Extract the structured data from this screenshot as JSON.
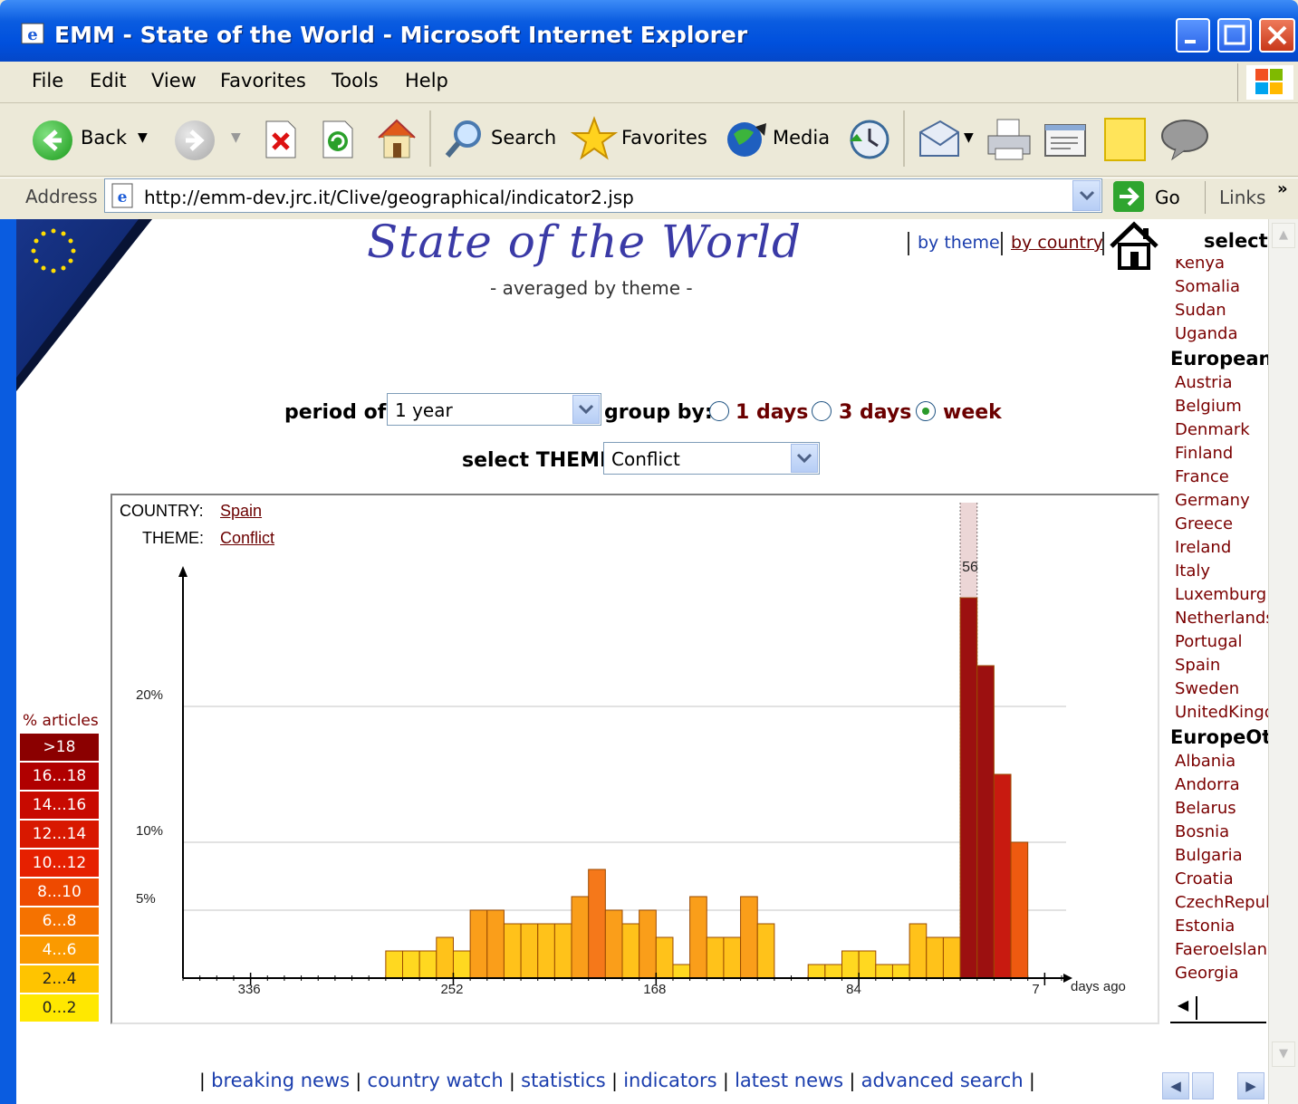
{
  "window": {
    "title": "EMM - State of the World - Microsoft Internet Explorer"
  },
  "menu": [
    "File",
    "Edit",
    "View",
    "Favorites",
    "Tools",
    "Help"
  ],
  "toolbar": {
    "back": "Back",
    "search": "Search",
    "favorites": "Favorites",
    "media": "Media"
  },
  "address": {
    "label": "Address",
    "url": "http://emm-dev.jrc.it/Clive/geographical/indicator2.jsp",
    "go": "Go",
    "links": "Links"
  },
  "page": {
    "title": "State of the World",
    "subtitle": "- averaged by theme -",
    "top_links": [
      "by theme",
      "by country"
    ],
    "period_label": "period of:",
    "period_value": "1 year",
    "group_label": "group by:",
    "group_options": [
      "1 days",
      "3 days",
      "week"
    ],
    "group_selected": "week",
    "theme_label": "select THEME",
    "theme_value": "Conflict",
    "country_label": "COUNTRY:",
    "country_value": "Spain",
    "theme_row_label": "THEME:",
    "theme_row_value": "Conflict",
    "right_header": "select"
  },
  "country_list": [
    {
      "type": "item",
      "text": "Kenya"
    },
    {
      "type": "item",
      "text": "Somalia"
    },
    {
      "type": "item",
      "text": "Sudan"
    },
    {
      "type": "item",
      "text": "Uganda"
    },
    {
      "type": "header",
      "text": "European"
    },
    {
      "type": "item",
      "text": "Austria"
    },
    {
      "type": "item",
      "text": "Belgium"
    },
    {
      "type": "item",
      "text": "Denmark"
    },
    {
      "type": "item",
      "text": "Finland"
    },
    {
      "type": "item",
      "text": "France"
    },
    {
      "type": "item",
      "text": "Germany"
    },
    {
      "type": "item",
      "text": "Greece"
    },
    {
      "type": "item",
      "text": "Ireland"
    },
    {
      "type": "item",
      "text": "Italy"
    },
    {
      "type": "item",
      "text": "Luxemburg"
    },
    {
      "type": "item",
      "text": "Netherlands"
    },
    {
      "type": "item",
      "text": "Portugal"
    },
    {
      "type": "item",
      "text": "Spain"
    },
    {
      "type": "item",
      "text": "Sweden"
    },
    {
      "type": "item",
      "text": "UnitedKingd"
    },
    {
      "type": "header",
      "text": "EuropeOt"
    },
    {
      "type": "item",
      "text": "Albania"
    },
    {
      "type": "item",
      "text": "Andorra"
    },
    {
      "type": "item",
      "text": "Belarus"
    },
    {
      "type": "item",
      "text": "Bosnia"
    },
    {
      "type": "item",
      "text": "Bulgaria"
    },
    {
      "type": "item",
      "text": "Croatia"
    },
    {
      "type": "item",
      "text": "CzechRepub"
    },
    {
      "type": "item",
      "text": "Estonia"
    },
    {
      "type": "item",
      "text": "FaeroeIslan"
    },
    {
      "type": "item",
      "text": "Georgia"
    }
  ],
  "legend": {
    "title": "% articles",
    "items": [
      {
        "label": ">18",
        "color": "#8b0000"
      },
      {
        "label": "16...18",
        "color": "#b00000"
      },
      {
        "label": "14...16",
        "color": "#c80a00"
      },
      {
        "label": "12...14",
        "color": "#d81800"
      },
      {
        "label": "10...12",
        "color": "#e62000"
      },
      {
        "label": "8...10",
        "color": "#ee4a00"
      },
      {
        "label": "6...8",
        "color": "#f57200"
      },
      {
        "label": "4...6",
        "color": "#fa9a00"
      },
      {
        "label": "2...4",
        "color": "#ffc400"
      },
      {
        "label": "0...2",
        "color": "#ffe800"
      }
    ]
  },
  "chart_data": {
    "type": "bar",
    "xlabel": "days ago",
    "ylabel": "",
    "x_ticks": [
      "336",
      "252",
      "168",
      "84",
      "7"
    ],
    "y_ticks": [
      "20%",
      "10%",
      "5%"
    ],
    "y_tick_values": [
      20,
      10,
      5
    ],
    "ylim": [
      0,
      30
    ],
    "xlim": [
      364,
      0
    ],
    "annotation": "56",
    "bar_width_days": 7,
    "bars": [
      {
        "x": 273,
        "value": 2
      },
      {
        "x": 266,
        "value": 2
      },
      {
        "x": 259,
        "value": 2
      },
      {
        "x": 252,
        "value": 3
      },
      {
        "x": 245,
        "value": 2
      },
      {
        "x": 238,
        "value": 5
      },
      {
        "x": 231,
        "value": 5
      },
      {
        "x": 224,
        "value": 4
      },
      {
        "x": 217,
        "value": 4
      },
      {
        "x": 210,
        "value": 4
      },
      {
        "x": 203,
        "value": 4
      },
      {
        "x": 196,
        "value": 6
      },
      {
        "x": 189,
        "value": 8
      },
      {
        "x": 182,
        "value": 5
      },
      {
        "x": 175,
        "value": 4
      },
      {
        "x": 168,
        "value": 5
      },
      {
        "x": 161,
        "value": 3
      },
      {
        "x": 154,
        "value": 1
      },
      {
        "x": 147,
        "value": 6
      },
      {
        "x": 140,
        "value": 3
      },
      {
        "x": 133,
        "value": 3
      },
      {
        "x": 126,
        "value": 6
      },
      {
        "x": 119,
        "value": 4
      },
      {
        "x": 98,
        "value": 1
      },
      {
        "x": 91,
        "value": 1
      },
      {
        "x": 84,
        "value": 2
      },
      {
        "x": 77,
        "value": 2
      },
      {
        "x": 70,
        "value": 1
      },
      {
        "x": 63,
        "value": 1
      },
      {
        "x": 56,
        "value": 4
      },
      {
        "x": 49,
        "value": 3
      },
      {
        "x": 42,
        "value": 3
      },
      {
        "x": 35,
        "value": 28
      },
      {
        "x": 28,
        "value": 23
      },
      {
        "x": 21,
        "value": 15
      },
      {
        "x": 14,
        "value": 10
      }
    ]
  },
  "footer_links": [
    "breaking news",
    "country watch",
    "statistics",
    "indicators",
    "latest news",
    "advanced search"
  ]
}
